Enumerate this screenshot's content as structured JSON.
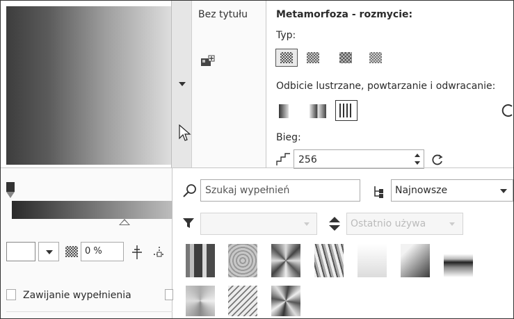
{
  "object_tab": {
    "label": "Bez tytułu"
  },
  "props": {
    "heading": "Metamorfoza - rozmycie:",
    "type_label": "Typ:",
    "mirror_label": "Odbicie lustrzane, powtarzanie i odwracanie:",
    "steps_label": "Bieg:",
    "steps_value": "256"
  },
  "library": {
    "search_placeholder": "Szukaj wypełnień",
    "sort_value": "Najnowsze",
    "filter_value": "",
    "recent_value": "Ostatnio używa"
  },
  "left": {
    "transparency_value": "0 %",
    "wrap_label": "Zawijanie wypełnienia"
  },
  "icons": {
    "add": "add-fill-icon",
    "collapse": "collapse-arrow-icon",
    "cursor": "mouse-pointer-icon",
    "search": "search-icon",
    "sort": "sort-tree-icon",
    "filter": "funnel-icon",
    "updown": "sort-updown-icon",
    "steps": "steps-icon",
    "reset": "refresh-icon",
    "dropdown": "chevron-down-icon",
    "checker": "checker-icon"
  },
  "colors": {
    "panel_border": "#c7c7c7",
    "accent_strip": "#6a6a6a",
    "selected_border": "#2a2a2a"
  }
}
